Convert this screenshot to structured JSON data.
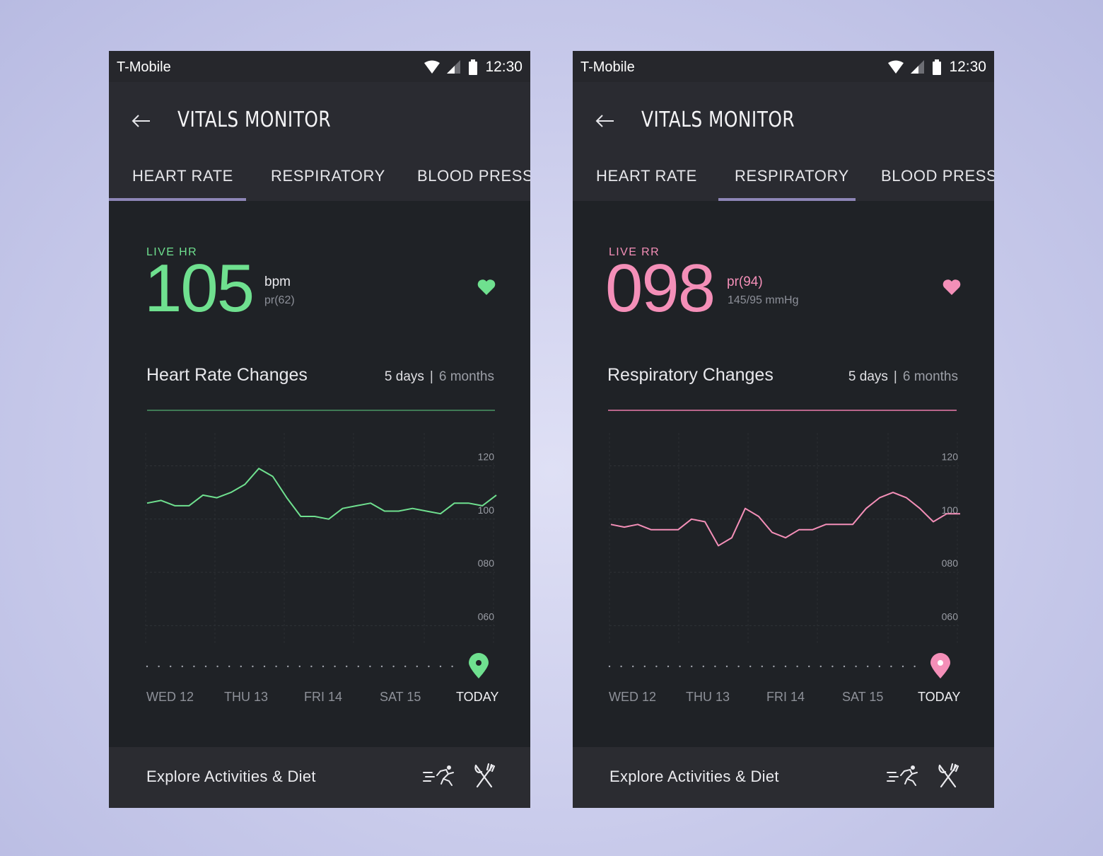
{
  "phones": [
    {
      "status": {
        "carrier": "T-Mobile",
        "time": "12:30"
      },
      "app_title": "VITALS MONITOR",
      "tabs": [
        "HEART RATE",
        "RESPIRATORY",
        "BLOOD PRESSU"
      ],
      "active_tab": "HEART RATE",
      "live_label": "LIVE HR",
      "live_value": "105",
      "sub_line_1": "bpm",
      "sub_line_2": "pr(62)",
      "section_title": "Heart Rate Changes",
      "range_options": [
        "5 days",
        "6 months"
      ],
      "range_separator": "|",
      "selected_range": "5 days",
      "days": [
        "WED 12",
        "THU 13",
        "FRI 14",
        "SAT 15",
        "TODAY"
      ],
      "explore_label": "Explore Activities & Diet",
      "accent_color": "#6fe08f",
      "icons": {
        "back": "arrow-left-icon",
        "favorite": "heart-icon",
        "location": "location-pin-icon",
        "activity": "running-person-icon",
        "diet": "fork-knife-icon"
      },
      "chart_data": {
        "type": "line",
        "title": "Heart Rate Changes",
        "y_ticks": [
          "120",
          "100",
          "080",
          "060"
        ],
        "ylim": [
          50,
          135
        ],
        "grid": true,
        "values": [
          106,
          107,
          105,
          105,
          109,
          108,
          110,
          113,
          119,
          116,
          108,
          101,
          101,
          100,
          104,
          105,
          106,
          103,
          103,
          104,
          103,
          102,
          106,
          106,
          105,
          109
        ]
      }
    },
    {
      "status": {
        "carrier": "T-Mobile",
        "time": "12:30"
      },
      "app_title": "VITALS MONITOR",
      "tabs": [
        "HEART RATE",
        "RESPIRATORY",
        "BLOOD PRESSU"
      ],
      "active_tab": "RESPIRATORY",
      "live_label": "LIVE RR",
      "live_value": "098",
      "sub_line_1": "pr(94)",
      "sub_line_2": "145/95 mmHg",
      "section_title": "Respiratory Changes",
      "range_options": [
        "5 days",
        "6 months"
      ],
      "range_separator": "|",
      "selected_range": "5 days",
      "days": [
        "WED 12",
        "THU 13",
        "FRI 14",
        "SAT 15",
        "TODAY"
      ],
      "explore_label": "Explore Activities & Diet",
      "accent_color": "#f48fb8",
      "icons": {
        "back": "arrow-left-icon",
        "favorite": "heart-icon",
        "location": "location-pin-icon",
        "activity": "running-person-icon",
        "diet": "fork-knife-icon"
      },
      "chart_data": {
        "type": "line",
        "title": "Respiratory Changes",
        "y_ticks": [
          "120",
          "100",
          "080",
          "060"
        ],
        "ylim": [
          50,
          135
        ],
        "grid": true,
        "values": [
          98,
          97,
          98,
          96,
          96,
          96,
          100,
          99,
          90,
          93,
          104,
          101,
          95,
          93,
          96,
          96,
          98,
          98,
          98,
          104,
          108,
          110,
          108,
          104,
          99,
          102,
          102
        ]
      }
    }
  ]
}
